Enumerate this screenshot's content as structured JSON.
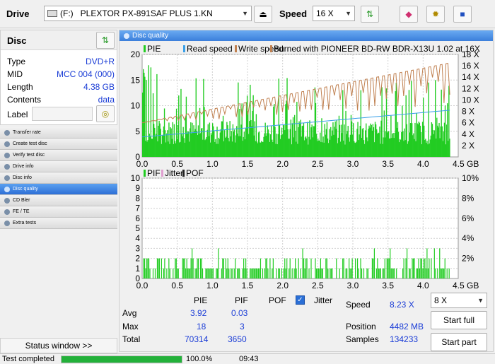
{
  "toolbar": {
    "drive_label": "Drive",
    "drive_letter": "(F:)",
    "drive_name": "PLEXTOR PX-891SAF PLUS 1.KN",
    "speed_label": "Speed",
    "speed_value": "16 X"
  },
  "disc": {
    "title": "Disc",
    "fields": [
      {
        "label": "Type",
        "value": "DVD+R"
      },
      {
        "label": "MID",
        "value": "MCC 004 (000)"
      },
      {
        "label": "Length",
        "value": "4.38 GB"
      },
      {
        "label": "Contents",
        "value": "data"
      }
    ],
    "label_label": "Label",
    "label_value": ""
  },
  "nav": [
    {
      "label": "Transfer rate",
      "selected": false
    },
    {
      "label": "Create test disc",
      "selected": false
    },
    {
      "label": "Verify test disc",
      "selected": false
    },
    {
      "label": "Drive info",
      "selected": false
    },
    {
      "label": "Disc info",
      "selected": false
    },
    {
      "label": "Disc quality",
      "selected": true
    },
    {
      "label": "CD Bler",
      "selected": false
    },
    {
      "label": "FE / TE",
      "selected": false
    },
    {
      "label": "Extra tests",
      "selected": false
    }
  ],
  "status_window_label": "Status window >>",
  "statusbar": {
    "text": "Test completed",
    "progress": 1.0,
    "percent": "100.0%",
    "time": "09:43"
  },
  "main": {
    "title": "Disc quality",
    "stats": {
      "col_pie": "PIE",
      "col_pif": "PIF",
      "col_pof": "POF",
      "jitter_label": "Jitter",
      "avg_label": "Avg",
      "avg_pie": "3.92",
      "avg_pif": "0.03",
      "max_label": "Max",
      "max_pie": "18",
      "max_pif": "3",
      "total_label": "Total",
      "total_pie": "70314",
      "total_pif": "3650",
      "speed_label": "Speed",
      "speed_value": "8.23 X",
      "position_label": "Position",
      "position_value": "4482 MB",
      "samples_label": "Samples",
      "samples_value": "134233",
      "speed_select": "8 X",
      "start_full": "Start full",
      "start_part": "Start part"
    }
  },
  "chart_data": [
    {
      "type": "bar",
      "legend": [
        "PIE",
        "Read speed",
        "Write speed",
        "Burned with PIONEER BD-RW   BDR-X13U 1.02 at 16X"
      ],
      "x_ticks": [
        "0.0",
        "0.5",
        "1.0",
        "1.5",
        "2.0",
        "2.5",
        "3.0",
        "3.5",
        "4.0",
        "4.5 GB"
      ],
      "y_left_ticks": [
        "5",
        "10",
        "15",
        "20"
      ],
      "y_right_ticks": [
        "2 X",
        "4 X",
        "6 X",
        "8 X",
        "10 X",
        "12 X",
        "14 X",
        "16 X",
        "18 X"
      ],
      "xlim": [
        0,
        4.5
      ],
      "ylim": [
        0,
        20
      ],
      "y2lim": [
        0,
        18
      ],
      "pie_typical": 6,
      "pie_max": 18,
      "write_speed_start": 6,
      "write_speed_end": 16.5,
      "read_speed_start": 3.5,
      "read_speed_end": 8.2
    },
    {
      "type": "bar",
      "legend": [
        "PIF",
        "Jitter",
        "POF"
      ],
      "x_ticks": [
        "0.0",
        "0.5",
        "1.0",
        "1.5",
        "2.0",
        "2.5",
        "3.0",
        "3.5",
        "4.0",
        "4.5 GB"
      ],
      "y_left_ticks": [
        "1",
        "2",
        "3",
        "4",
        "5",
        "6",
        "7",
        "8",
        "9",
        "10"
      ],
      "y_right_ticks": [
        "2%",
        "4%",
        "6%",
        "8%",
        "10%"
      ],
      "xlim": [
        0,
        4.5
      ],
      "ylim": [
        0,
        10
      ],
      "pif_typical": 1,
      "pif_max": 3
    }
  ]
}
